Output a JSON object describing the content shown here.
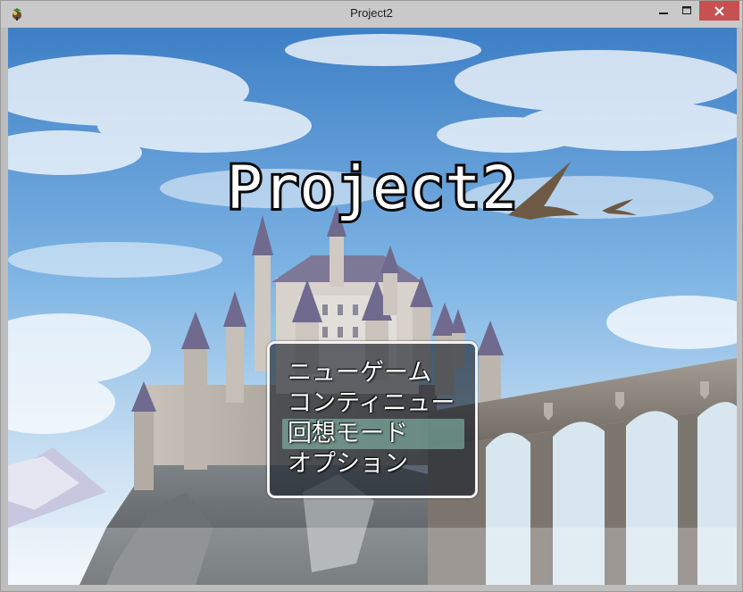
{
  "window": {
    "title": "Project2"
  },
  "game": {
    "title": "Project2"
  },
  "menu": {
    "items": [
      {
        "label": "ニューゲーム",
        "selected": false
      },
      {
        "label": "コンティニュー",
        "selected": false
      },
      {
        "label": "回想モード",
        "selected": true
      },
      {
        "label": "オプション",
        "selected": false
      }
    ]
  },
  "colors": {
    "close_button": "#c75050",
    "menu_highlight": "#8cc8b4",
    "sky": "#4f8fd0"
  },
  "icons": {
    "app": "rpg-maker-app-icon",
    "minimize": "minimize-icon",
    "maximize": "maximize-icon",
    "close": "close-icon"
  }
}
